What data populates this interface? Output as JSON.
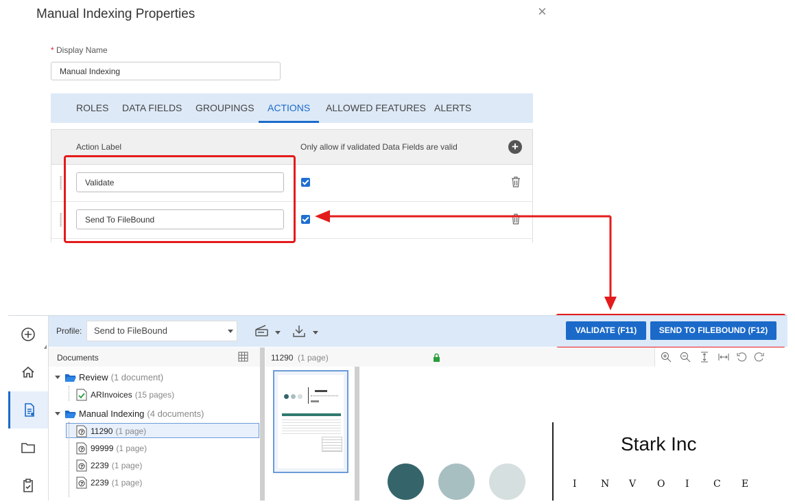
{
  "dialog": {
    "title": "Manual Indexing Properties",
    "close_glyph": "×",
    "display_name_required_mark": "*",
    "display_name_label": "Display Name",
    "display_name_value": "Manual Indexing",
    "tabs": [
      {
        "label": "ROLES"
      },
      {
        "label": "DATA FIELDS"
      },
      {
        "label": "GROUPINGS"
      },
      {
        "label": "ACTIONS",
        "active": true
      },
      {
        "label": "ALLOWED FEATURES"
      },
      {
        "label": "ALERTS"
      }
    ],
    "grid": {
      "col_action_label": "Action Label",
      "col_only_allow": "Only allow if validated Data Fields are valid",
      "add_glyph": "+",
      "rows": [
        {
          "label": "Validate",
          "checked": true
        },
        {
          "label": "Send To FileBound",
          "checked": true
        }
      ]
    }
  },
  "app": {
    "nav_icons": [
      "add-circle-icon",
      "home-icon",
      "document-indexing-icon",
      "folder-icon",
      "clipboard-check-icon"
    ],
    "toolbar": {
      "profile_label": "Profile:",
      "profile_value": "Send to FileBound",
      "validate_button": "VALIDATE (F11)",
      "send_button": "SEND TO FILEBOUND (F12)"
    },
    "documents": {
      "header": "Documents",
      "tree": [
        {
          "label": "Review",
          "count": "(1 document)"
        },
        {
          "label": "ARInvoices",
          "count": "(15 pages)"
        },
        {
          "label": "Manual Indexing",
          "count": "(4 documents)"
        },
        {
          "label": "11290",
          "count": "(1 page)",
          "selected": true
        },
        {
          "label": "99999",
          "count": "(1 page)"
        },
        {
          "label": "2239",
          "count": "(1 page)"
        },
        {
          "label": "2239",
          "count": "(1 page)"
        }
      ]
    },
    "viewer": {
      "doc_label": "11290",
      "doc_pages": "(1 page)",
      "company": "Stark Inc",
      "invoice_letters": [
        "I",
        "N",
        "V",
        "O",
        "I",
        "C",
        "E"
      ],
      "circle_colors": [
        "#35656a",
        "#a8bfc2",
        "#d5dfdf"
      ]
    }
  },
  "colors": {
    "accent": "#1b6ac9",
    "annotation": "#e41b1b",
    "tab_bar": "#dde9f7",
    "toolbar": "#dce9f8"
  }
}
